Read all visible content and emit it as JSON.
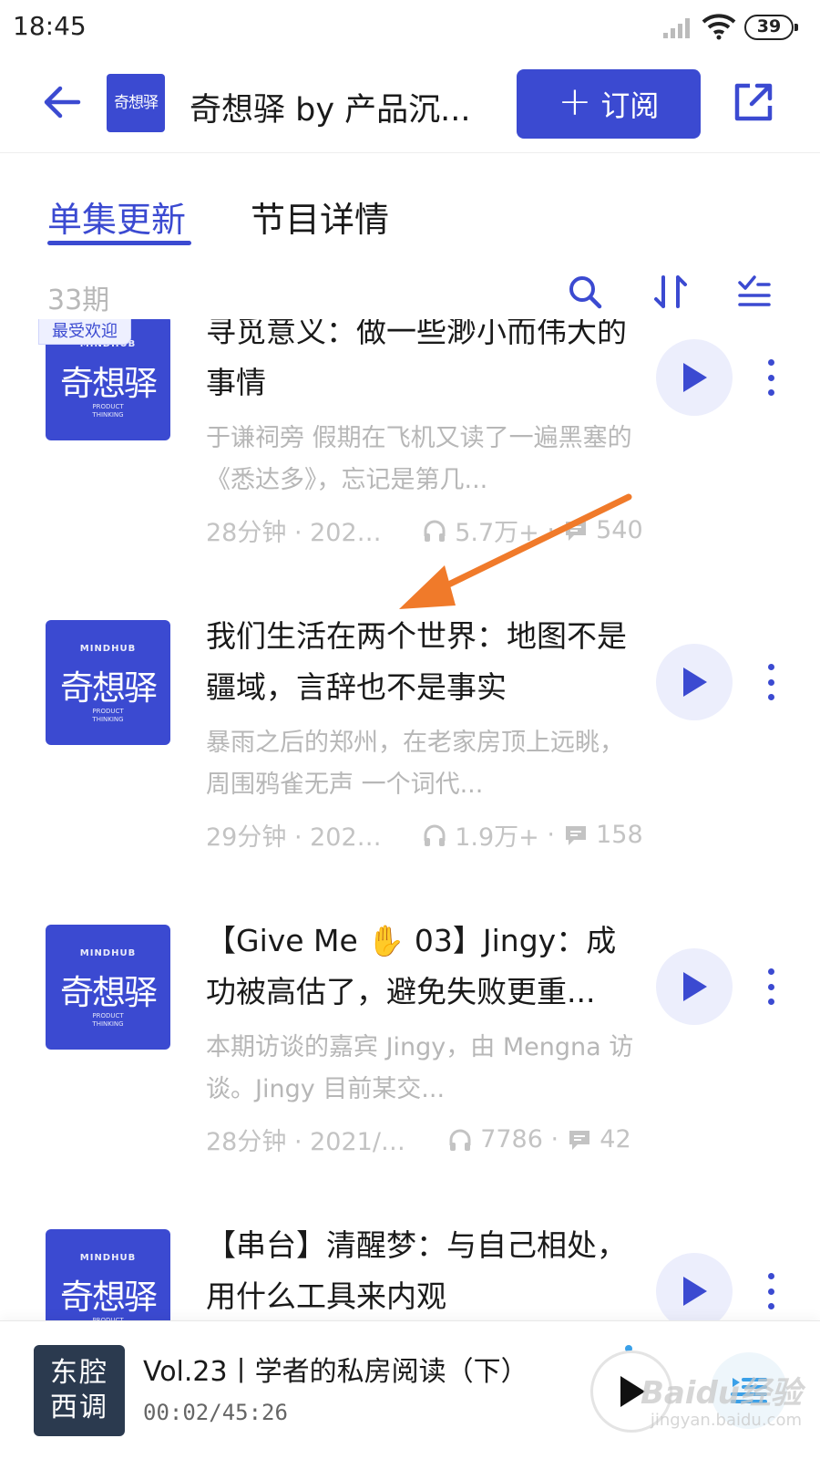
{
  "status_bar": {
    "time": "18:45",
    "battery": "39"
  },
  "header": {
    "title": "奇想驿 by 产品沉...",
    "subscribe_label": "订阅",
    "cover_text": "奇想驿"
  },
  "tabs": [
    {
      "label": "单集更新",
      "active": true
    },
    {
      "label": "节目详情",
      "active": false
    }
  ],
  "toolbar": {
    "episode_count": "33期"
  },
  "cover_brand": {
    "top": "MINDHUB",
    "main": "奇想驿",
    "bottom_1": "PRODUCT",
    "bottom_2": "THINKING"
  },
  "episodes": [
    {
      "badge": "最受欢迎",
      "title": "寻觅意义：做一些渺小而伟大的事情",
      "description": "于谦祠旁 假期在飞机又读了一遍黑塞的《悉达多》，忘记是第几...",
      "duration": "28分钟 · 2021...",
      "plays": "5.7万+",
      "comments": "540"
    },
    {
      "badge": "",
      "title": "我们生活在两个世界：地图不是疆域，言辞也不是事实",
      "description": "暴雨之后的郑州，在老家房顶上远眺，周围鸦雀无声 一个词代...",
      "duration": "29分钟 · 2021...",
      "plays": "1.9万+",
      "comments": "158"
    },
    {
      "badge": "",
      "title": "【Give Me ✋ 03】Jingy：成功被高估了，避免失败更重...",
      "description": "本期访谈的嘉宾 Jingy，由 Mengna 访谈。Jingy 目前某交...",
      "duration": "28分钟 · 2021/0...",
      "plays": "7786",
      "comments": "42"
    },
    {
      "badge": "",
      "title": "【串台】清醒梦：与自己相处，用什么工具来内观",
      "description": "",
      "duration": "",
      "plays": "",
      "comments": ""
    }
  ],
  "player": {
    "cover_text_1": "东腔",
    "cover_text_2": "西调",
    "title": "Vol.23丨学者的私房阅读（下）",
    "time": "00:02/45:26"
  },
  "watermark": {
    "line1": "Baidu经验",
    "line2": "jingyan.baidu.com"
  },
  "colors": {
    "accent": "#3b4ad1",
    "annotation_arrow": "#f07a2a",
    "muted_text": "#b7b7b7"
  }
}
